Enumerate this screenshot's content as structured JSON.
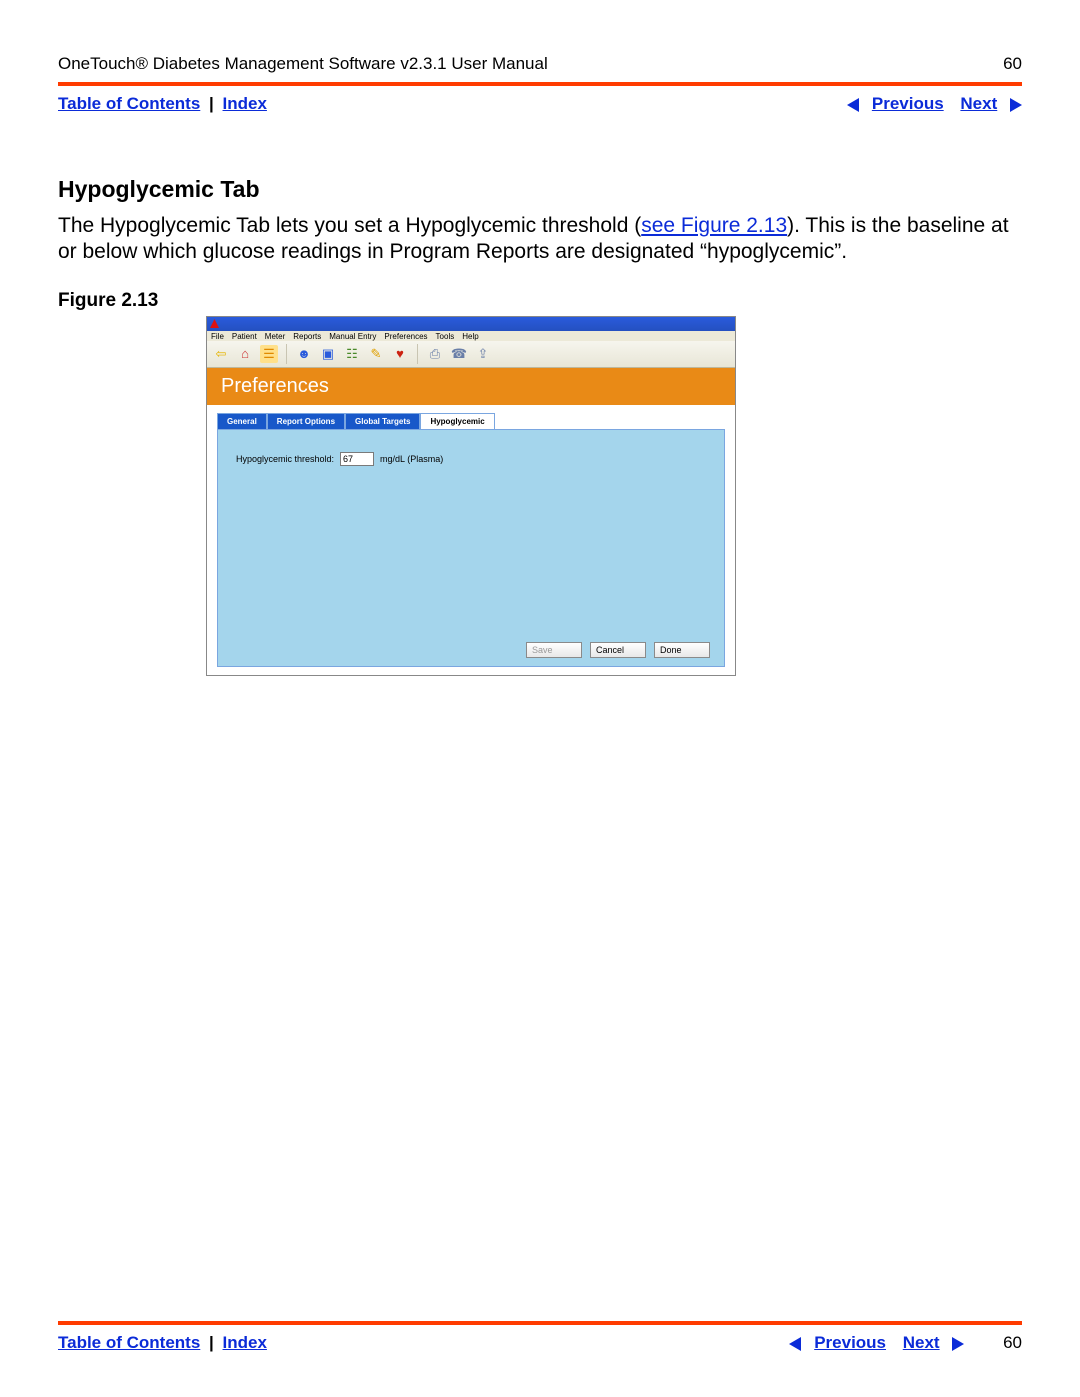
{
  "header": {
    "doc_title": "OneTouch® Diabetes Management Software v2.3.1 User Manual",
    "page_number": "60"
  },
  "nav": {
    "toc": "Table of Contents",
    "index": "Index",
    "previous": "Previous",
    "next": "Next",
    "sep": "|"
  },
  "section": {
    "title": "Hypoglycemic Tab",
    "body_before_link": "The Hypoglycemic Tab lets you set a Hypoglycemic threshold (",
    "body_link": "see Figure 2.13",
    "body_after_link": "). This is the baseline at or below which glucose readings in Program Reports are designated “hypoglycemic”."
  },
  "figure": {
    "label": "Figure 2.13"
  },
  "screenshot": {
    "menu": [
      "File",
      "Patient",
      "Meter",
      "Reports",
      "Manual Entry",
      "Preferences",
      "Tools",
      "Help"
    ],
    "banner": "Preferences",
    "tabs": {
      "general": "General",
      "report_options": "Report Options",
      "global_targets": "Global Targets",
      "hypoglycemic": "Hypoglycemic"
    },
    "field": {
      "label": "Hypoglycemic threshold:",
      "value": "67",
      "unit": "mg/dL (Plasma)"
    },
    "buttons": {
      "save": "Save",
      "cancel": "Cancel",
      "done": "Done"
    }
  },
  "toolbar_icons": {
    "back": "⇦",
    "home": "⌂",
    "list": "☰",
    "patient": "☻",
    "meter": "▣",
    "report": "☷",
    "pencil": "✎",
    "heart": "♥",
    "print": "⎙",
    "fax": "☎",
    "export": "⇪"
  }
}
